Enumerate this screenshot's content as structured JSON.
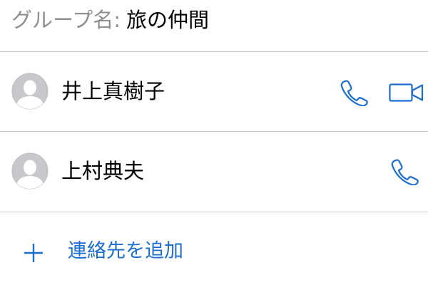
{
  "group": {
    "label_prefix": "グループ名:",
    "name": "旅の仲間"
  },
  "contacts": [
    {
      "name": "井上真樹子",
      "actions": [
        "phone-icon",
        "video-camera-icon"
      ]
    },
    {
      "name": "上村典夫",
      "actions": [
        "phone-icon"
      ]
    }
  ],
  "add_contact": {
    "icon": "plus-icon",
    "label": "連絡先を追加"
  },
  "colors": {
    "accent": "#1c6dd0",
    "divider": "#c8c7cc",
    "avatar_bg": "#c7c7cc",
    "secondary_text": "#8e8e93"
  }
}
